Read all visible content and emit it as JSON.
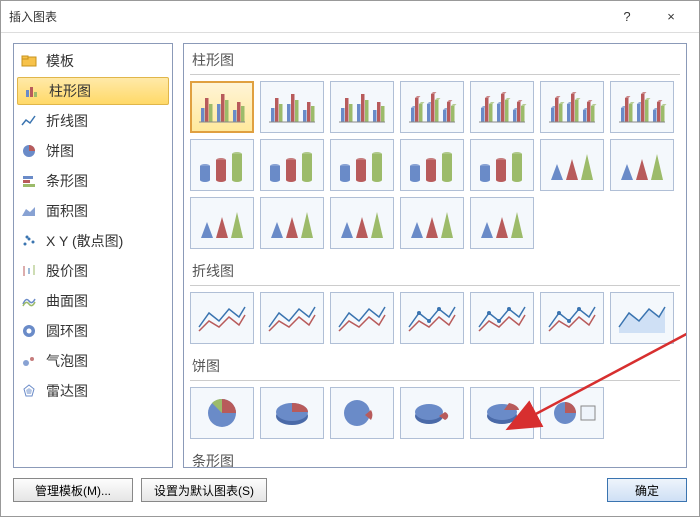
{
  "dialog": {
    "title": "插入图表"
  },
  "titlebar": {
    "help": "?",
    "close": "×"
  },
  "sidebar": {
    "items": [
      {
        "label": "模板",
        "icon": "folder"
      },
      {
        "label": "柱形图",
        "icon": "column"
      },
      {
        "label": "折线图",
        "icon": "line"
      },
      {
        "label": "饼图",
        "icon": "pie"
      },
      {
        "label": "条形图",
        "icon": "bar"
      },
      {
        "label": "面积图",
        "icon": "area"
      },
      {
        "label": "X Y (散点图)",
        "icon": "scatter"
      },
      {
        "label": "股价图",
        "icon": "stock"
      },
      {
        "label": "曲面图",
        "icon": "surface"
      },
      {
        "label": "圆环图",
        "icon": "doughnut"
      },
      {
        "label": "气泡图",
        "icon": "bubble"
      },
      {
        "label": "雷达图",
        "icon": "radar"
      }
    ],
    "selected_index": 1
  },
  "sections": [
    {
      "label": "柱形图",
      "kind": "column",
      "thumb_count": 19,
      "selected": 0
    },
    {
      "label": "折线图",
      "kind": "line",
      "thumb_count": 7
    },
    {
      "label": "饼图",
      "kind": "pie",
      "thumb_count": 6
    },
    {
      "label": "条形图",
      "kind": "bar",
      "thumb_count": 0,
      "partial": true
    }
  ],
  "footer": {
    "manage_templates": "管理模板(M)...",
    "set_default": "设置为默认图表(S)",
    "ok": "确定"
  }
}
